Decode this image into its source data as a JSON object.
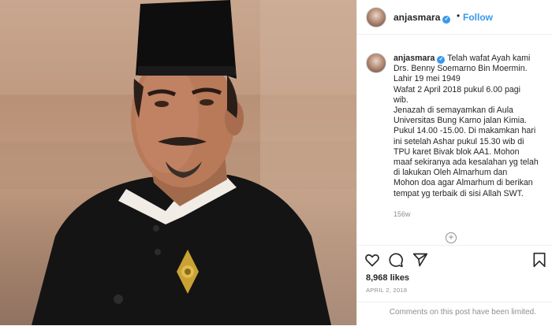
{
  "header": {
    "username": "anjasmara",
    "separator": "•",
    "follow_label": "Follow"
  },
  "caption": {
    "username": "anjasmara",
    "lines": [
      "Telah wafat Ayah kami",
      "Drs. Benny Soemarno Bin Moermin.",
      "Lahir 19 mei 1949",
      "Wafat 2 April 2018 pukul 6.00 pagi",
      "wib.",
      "Jenazah di semayamkan di Aula",
      "Universitas Bung Karno jalan Kimia.",
      "Pukul 14.00 -15.00. Di makamkan hari",
      "ini setelah Ashar pukul 15.30 wib di",
      "TPU karet Bivak blok AA1. Mohon",
      "maaf sekiranya ada kesalahan yg telah",
      "di lakukan Oleh Almarhum dan",
      "Mohon doa agar Almarhum di berikan",
      "tempat yg terbaik di sisi Allah SWT."
    ],
    "time_ago": "156w"
  },
  "actions": {
    "likes": "8,968 likes",
    "date": "APRIL 2, 2018",
    "comments_limited": "Comments on this post have been limited."
  },
  "colors": {
    "link_blue": "#3897f0",
    "muted_gray": "#8e8e8e",
    "text_dark": "#262626",
    "border": "#efefef"
  },
  "icons": [
    "verified-badge-icon",
    "heart-icon",
    "comment-icon",
    "share-icon",
    "bookmark-icon",
    "load-more-icon"
  ]
}
